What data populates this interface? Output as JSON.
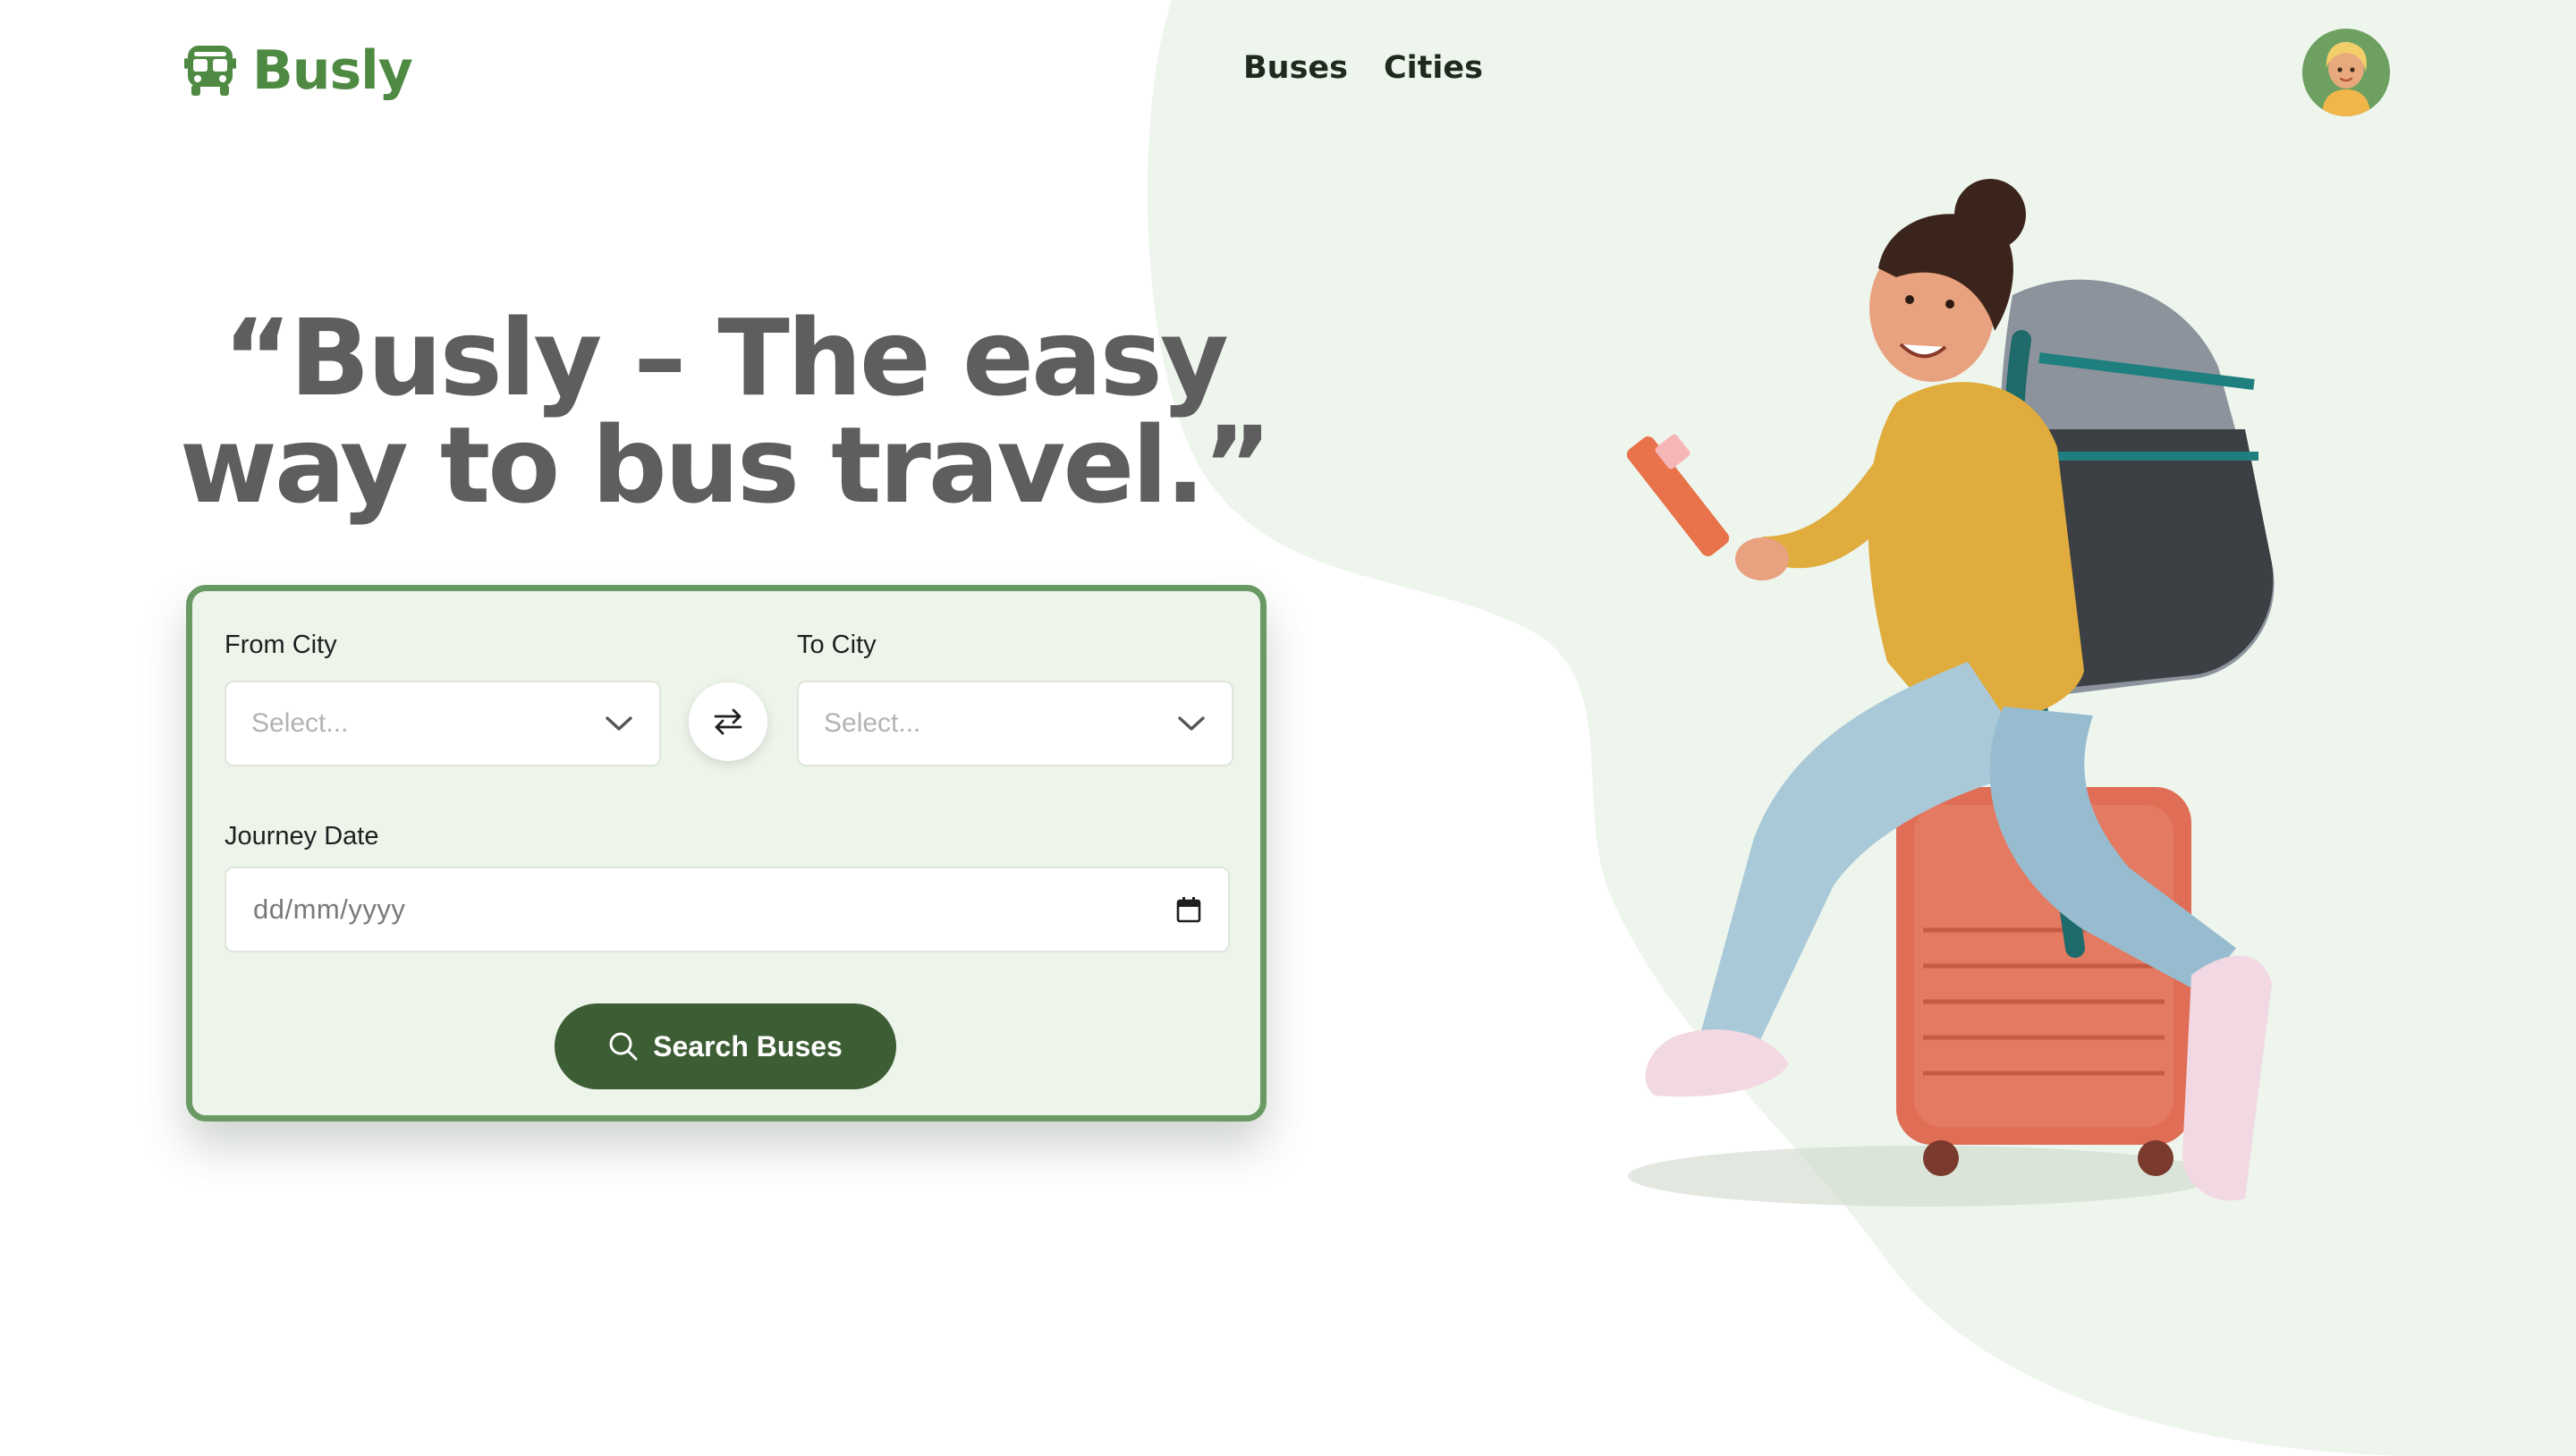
{
  "brand": {
    "name": "Busly",
    "color": "#4f8a43",
    "icon": "bus-icon"
  },
  "nav": {
    "items": [
      {
        "label": "Buses"
      },
      {
        "label": "Cities"
      }
    ]
  },
  "user": {
    "avatar": "user-avatar"
  },
  "hero": {
    "headline_line1": "“Busly – The easy",
    "headline_line2": "way to bus travel.”"
  },
  "search": {
    "from_label": "From City",
    "from_placeholder": "Select...",
    "to_label": "To City",
    "to_placeholder": "Select...",
    "swap_icon": "swap-arrows-icon",
    "date_label": "Journey Date",
    "date_placeholder": "dd/mm/yyyy",
    "date_icon": "calendar-icon",
    "button_label": "Search Buses",
    "button_icon": "search-icon"
  },
  "colors": {
    "accent": "#4f8a43",
    "button": "#3d5d34",
    "card_bg": "#edf4ea",
    "card_border": "#6a9a64",
    "blob": "#eef5ed",
    "headline": "#5e5e5e"
  }
}
